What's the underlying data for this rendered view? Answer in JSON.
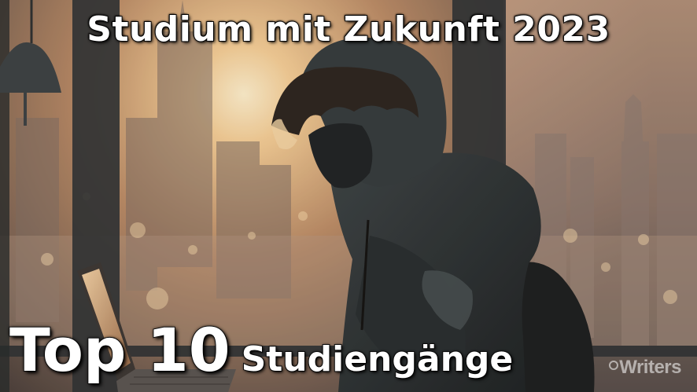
{
  "headline": "Studium mit Zukunft 2023",
  "top_label": "Top 10",
  "subject_label": "Studiengänge",
  "watermark": "Writers",
  "palette": {
    "sunset": "#f3c48a",
    "sky_warm": "#c89a70",
    "silhouette": "#1e2326",
    "hoodie": "#2d3538"
  }
}
